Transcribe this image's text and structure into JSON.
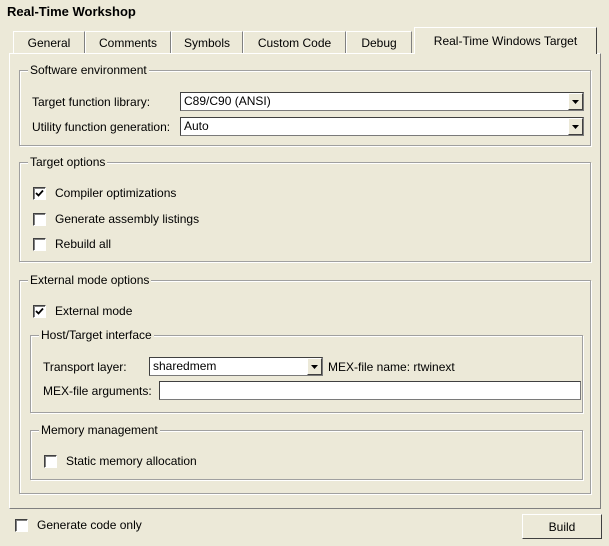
{
  "window": {
    "title": "Real-Time Workshop"
  },
  "tabs": [
    {
      "label": "General"
    },
    {
      "label": "Comments"
    },
    {
      "label": "Symbols"
    },
    {
      "label": "Custom Code"
    },
    {
      "label": "Debug"
    },
    {
      "label": "Real-Time Windows Target",
      "active": true
    }
  ],
  "software_environment": {
    "legend": "Software environment",
    "target_function_library": {
      "label": "Target function library:",
      "value": "C89/C90 (ANSI)"
    },
    "utility_function_generation": {
      "label": "Utility function generation:",
      "value": "Auto"
    }
  },
  "target_options": {
    "legend": "Target options",
    "compiler_optimizations": {
      "label": "Compiler optimizations",
      "checked": true
    },
    "generate_assembly_listings": {
      "label": "Generate assembly listings",
      "checked": false
    },
    "rebuild_all": {
      "label": "Rebuild all",
      "checked": false
    }
  },
  "external_mode_options": {
    "legend": "External mode options",
    "external_mode": {
      "label": "External mode",
      "checked": true
    },
    "host_target_interface": {
      "legend": "Host/Target interface",
      "transport_layer": {
        "label": "Transport layer:",
        "value": "sharedmem"
      },
      "mex_file_name": "MEX-file name: rtwinext",
      "mex_file_arguments": {
        "label": "MEX-file arguments:",
        "value": ""
      }
    },
    "memory_management": {
      "legend": "Memory management",
      "static_memory_allocation": {
        "label": "Static memory allocation",
        "checked": false
      }
    }
  },
  "footer": {
    "generate_code_only": {
      "label": "Generate code only",
      "checked": false
    },
    "build_label": "Build"
  }
}
